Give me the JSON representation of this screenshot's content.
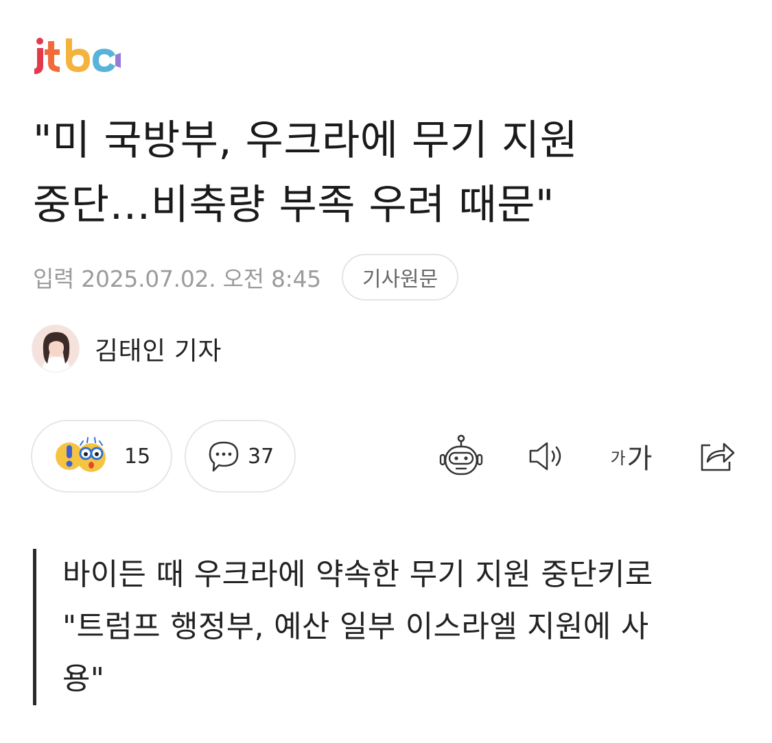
{
  "logo": {
    "text": "jtbc"
  },
  "article": {
    "title_line1": "\"미 국방부, 우크라에 무기 지원",
    "title_line2": "중단…비축량 부족 우려 때문\"",
    "date_label": "입력 2025.07.02. 오전 8:45",
    "original_button": "기사원문",
    "reporter": "김태인 기자"
  },
  "actions": {
    "reaction_count": "15",
    "comment_count": "37",
    "font_small": "가",
    "font_big": "가"
  },
  "summary": {
    "line1": "바이든 때 우크라에 약속한 무기 지원 중단키로",
    "line2": "\"트럼프 행정부, 예산 일부 이스라엘 지원에 사",
    "line3": "용\""
  },
  "colors": {
    "text": "#1a1a1a",
    "meta": "#9b9b9b",
    "border": "#e6e6e6",
    "quote_bar": "#2a2a2a"
  }
}
